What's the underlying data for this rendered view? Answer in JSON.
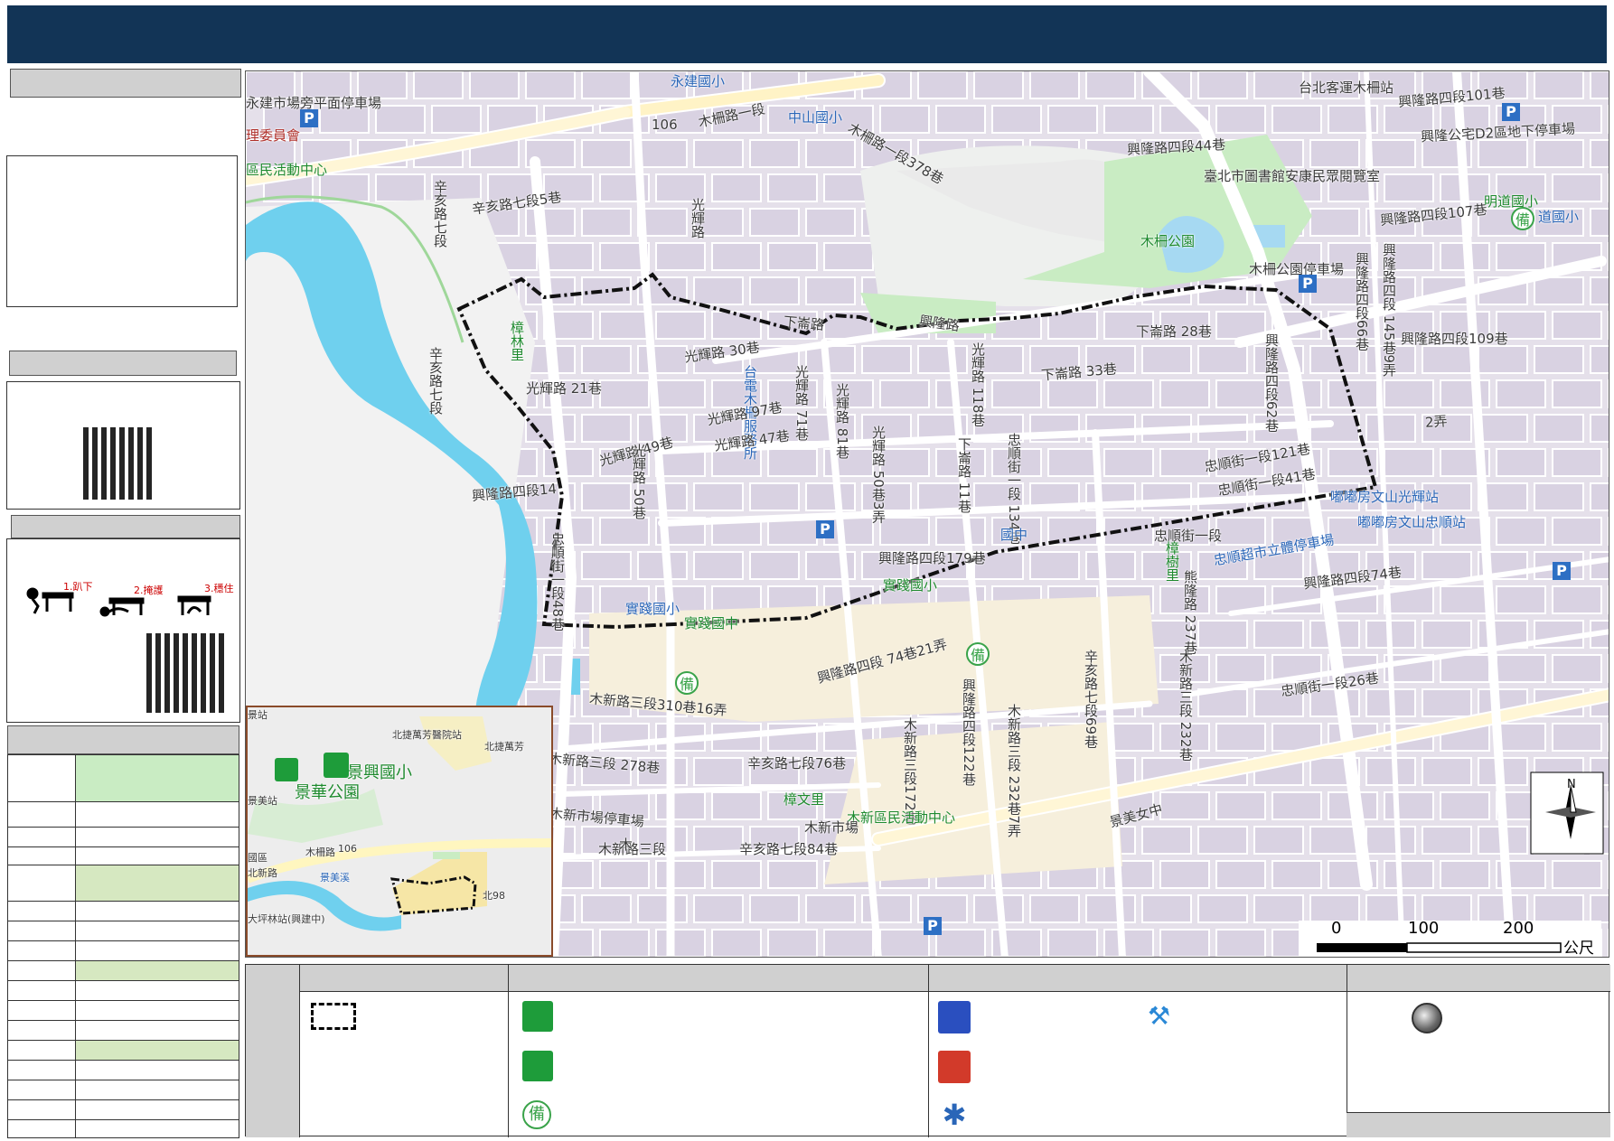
{
  "labels": [
    {
      "t": "永建國小",
      "c": "blue"
    },
    {
      "t": "永建市場旁平面停車場"
    },
    {
      "t": "106"
    },
    {
      "t": "木柵路一段"
    },
    {
      "t": "中山國小",
      "c": "blue"
    },
    {
      "t": "理委員會",
      "c": "red"
    },
    {
      "t": "區民活動中心",
      "c": "green"
    },
    {
      "t": "辛亥路七段"
    },
    {
      "t": "辛亥路七段5巷"
    },
    {
      "t": "光輝路"
    },
    {
      "t": "木柵路一段378巷"
    },
    {
      "t": "興隆路四段44巷"
    },
    {
      "t": "台北客運木柵站"
    },
    {
      "t": "興隆路四段101巷"
    },
    {
      "t": "興隆公宅D2區地下停車場"
    },
    {
      "t": "臺北市圖書館安康民眾閱覽室"
    },
    {
      "t": "明道國小",
      "c": "green"
    },
    {
      "t": "道國小",
      "c": "blue"
    },
    {
      "t": "興隆路四段107巷"
    },
    {
      "t": "木柵公園",
      "c": "green"
    },
    {
      "t": "木柵公園停車場"
    },
    {
      "t": "興隆路"
    },
    {
      "t": "下崙路"
    },
    {
      "t": "下崙路 28巷"
    },
    {
      "t": "樟林里",
      "c": "green"
    },
    {
      "t": "光輝路 30巷"
    },
    {
      "t": "光輝路 21巷"
    },
    {
      "t": "台電木柵服務所",
      "c": "blue"
    },
    {
      "t": "光輝路 71巷"
    },
    {
      "t": "光輝路 81巷"
    },
    {
      "t": "光輝路 97巷"
    },
    {
      "t": "光輝路 47巷"
    },
    {
      "t": "光輝路 49巷"
    },
    {
      "t": "光輝路 50巷"
    },
    {
      "t": "光輝路 50巷3弄"
    },
    {
      "t": "光輝路 118巷"
    },
    {
      "t": "下崙路 33巷"
    },
    {
      "t": "下崙路 11巷"
    },
    {
      "t": "忠順街一段 134巷"
    },
    {
      "t": "忠順街一段121巷"
    },
    {
      "t": "忠順街一段41巷"
    },
    {
      "t": "興隆路四段62巷"
    },
    {
      "t": "興隆路四段66巷"
    },
    {
      "t": "興隆路四段 145巷9弄"
    },
    {
      "t": "興隆路四段109巷"
    },
    {
      "t": "2弄"
    },
    {
      "t": "興隆路四段14"
    },
    {
      "t": "嘟嘟房文山光輝站",
      "c": "blue"
    },
    {
      "t": "嘟嘟房文山忠順站",
      "c": "blue"
    },
    {
      "t": "忠順超市立體停車場",
      "c": "blue"
    },
    {
      "t": "興隆路四段74巷"
    },
    {
      "t": "興隆路四段179巷"
    },
    {
      "t": "實踐國小",
      "c": "green"
    },
    {
      "t": "實踐國小",
      "c": "blue"
    },
    {
      "t": "實踐國中",
      "c": "green"
    },
    {
      "t": "國中",
      "c": "blue"
    },
    {
      "t": "忠順街一段"
    },
    {
      "t": "樟樹里",
      "c": "green"
    },
    {
      "t": "忠順街一段48巷"
    },
    {
      "t": "辛亥路七段"
    },
    {
      "t": "熊隆路 237巷"
    },
    {
      "t": "興隆路四段 74巷21弄"
    },
    {
      "t": "木新路三段310巷16弄"
    },
    {
      "t": "辛亥路七段69巷"
    },
    {
      "t": "忠順街一段26巷"
    },
    {
      "t": "興隆路四段122巷"
    },
    {
      "t": "木新路三段 232巷7弄"
    },
    {
      "t": "木新路三段 232巷"
    },
    {
      "t": "木新路三段172巷"
    },
    {
      "t": "木新路三段 278巷"
    },
    {
      "t": "辛亥路七段76巷"
    },
    {
      "t": "樟文里",
      "c": "green"
    },
    {
      "t": "木新區民活動中心",
      "c": "green"
    },
    {
      "t": "木新市場"
    },
    {
      "t": "木新市場停車場"
    },
    {
      "t": "辛亥路七段84巷"
    },
    {
      "t": "景美女中"
    },
    {
      "t": "木新路三段"
    },
    {
      "t": "木"
    }
  ],
  "scale": {
    "ticks": [
      "0",
      "100",
      "200"
    ],
    "unit": "公尺"
  },
  "north": "N",
  "inset": {
    "labels": [
      "北捷萬芳醫院站",
      "北捷萬芳",
      "景興國小",
      "景華公園",
      "木柵路",
      "106",
      "景美溪",
      "北新路",
      "大坪林站(興建中)",
      "北98",
      "景美站",
      "國區",
      "景站"
    ]
  },
  "drill": {
    "steps": [
      "1.趴下",
      "2.掩護",
      "3.穩住"
    ]
  },
  "legend": {
    "bei_char": "備"
  },
  "colors": {
    "banner": "#123456",
    "river": "#6fd0ee",
    "park": "#c8ebc0",
    "school": "#f6efdc",
    "road": "#ffffff",
    "boundary": "#111111"
  }
}
